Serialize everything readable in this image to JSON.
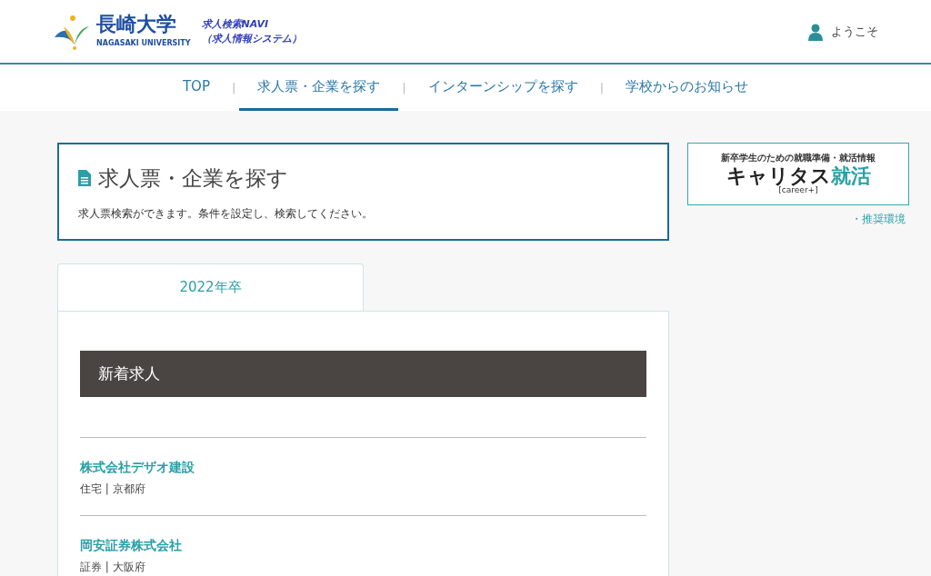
{
  "header": {
    "university_name": "長崎大学",
    "university_name_en": "NAGASAKI UNIVERSITY",
    "system_name": "求人検索NAVI",
    "system_subtitle": "（求人情報システム）",
    "welcome": "ようこそ"
  },
  "nav": [
    {
      "label": "TOP",
      "selected": false
    },
    {
      "label": "求人票・企業を探す",
      "selected": true
    },
    {
      "label": "インターンシップを探す",
      "selected": false
    },
    {
      "label": "学校からのお知らせ",
      "selected": false
    }
  ],
  "nav_separator": "|",
  "intro": {
    "title": "求人票・企業を探す",
    "description": "求人票検索ができます。条件を設定し、検索してください。"
  },
  "banner": {
    "tagline": "新卒学生のための就職準備・就活情報",
    "brand": "キャリタス",
    "brand_accent": "就活",
    "brand_sub": "[career+]"
  },
  "recommended_link": "・推奨環境",
  "tabs": [
    {
      "label": "2022年卒",
      "selected": true
    }
  ],
  "section_title": "新着求人",
  "jobs": [
    {
      "company": "株式会社デザオ建設",
      "detail": "住宅 | 京都府"
    },
    {
      "company": "岡安証券株式会社",
      "detail": "証券 | 大阪府"
    }
  ]
}
